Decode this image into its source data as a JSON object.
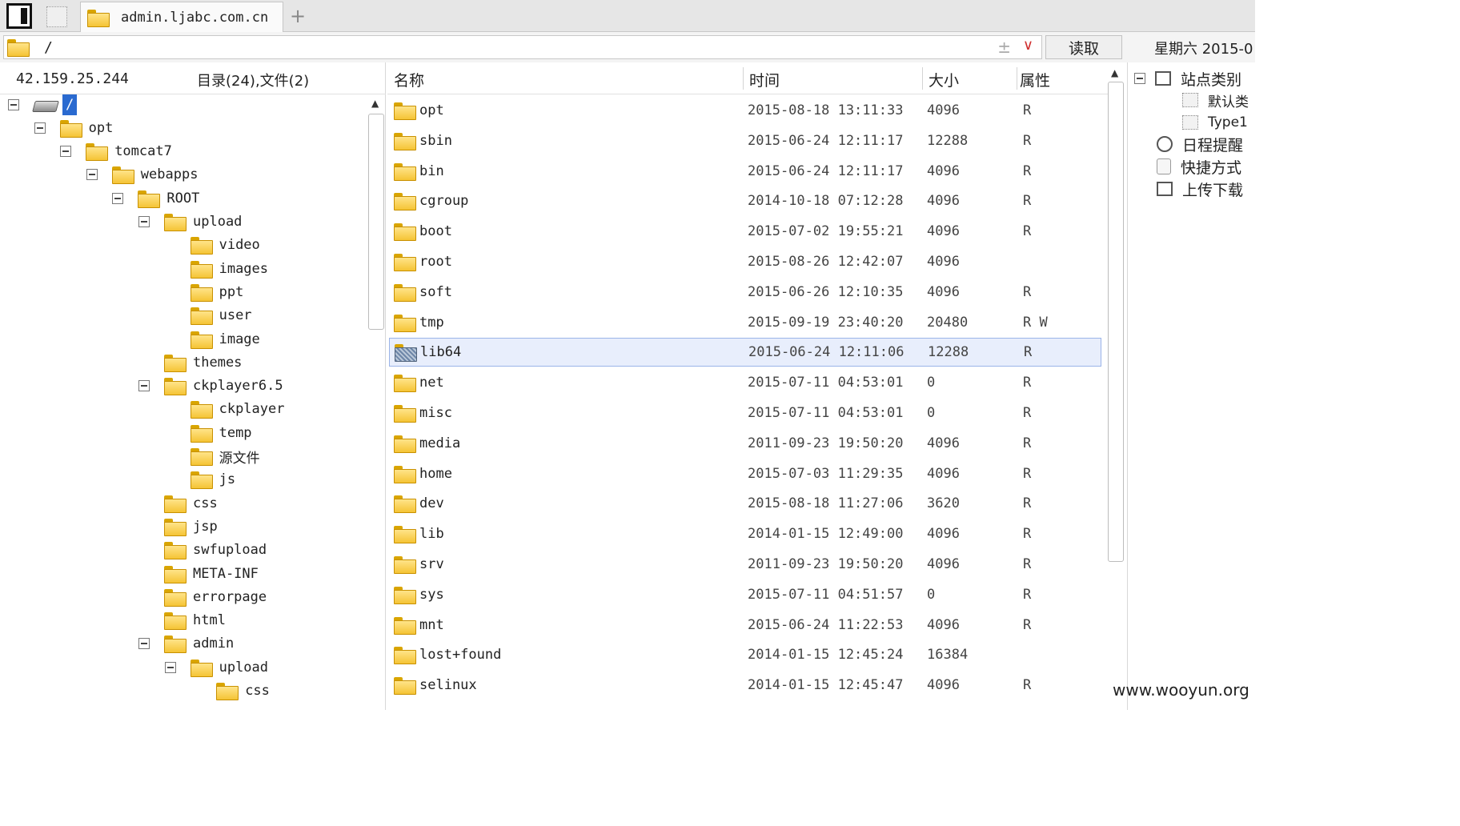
{
  "tab": {
    "title": "admin.ljabc.com.cn"
  },
  "path": {
    "value": "/",
    "read_label": "读取"
  },
  "weekday": "星期六 2015-0",
  "left": {
    "ip": "42.159.25.244",
    "counts": "目录(24),文件(2)",
    "tree": [
      {
        "label": "/",
        "kind": "drive",
        "depth": 0,
        "toggle": true
      },
      {
        "label": "opt",
        "depth": 1,
        "toggle": true
      },
      {
        "label": "tomcat7",
        "depth": 2,
        "toggle": true
      },
      {
        "label": "webapps",
        "depth": 3,
        "toggle": true
      },
      {
        "label": "ROOT",
        "depth": 4,
        "toggle": true
      },
      {
        "label": "upload",
        "depth": 5,
        "toggle": true
      },
      {
        "label": "video",
        "depth": 6
      },
      {
        "label": "images",
        "depth": 6
      },
      {
        "label": "ppt",
        "depth": 6
      },
      {
        "label": "user",
        "depth": 6
      },
      {
        "label": "image",
        "depth": 6
      },
      {
        "label": "themes",
        "depth": 5
      },
      {
        "label": "ckplayer6.5",
        "depth": 5,
        "toggle": true
      },
      {
        "label": "ckplayer",
        "depth": 6
      },
      {
        "label": "temp",
        "depth": 6
      },
      {
        "label": "源文件",
        "depth": 6
      },
      {
        "label": "js",
        "depth": 6
      },
      {
        "label": "css",
        "depth": 5
      },
      {
        "label": "jsp",
        "depth": 5
      },
      {
        "label": "swfupload",
        "depth": 5
      },
      {
        "label": "META-INF",
        "depth": 5
      },
      {
        "label": "errorpage",
        "depth": 5
      },
      {
        "label": "html",
        "depth": 5
      },
      {
        "label": "admin",
        "depth": 5,
        "toggle": true
      },
      {
        "label": "upload",
        "depth": 6,
        "toggle": true
      },
      {
        "label": "css",
        "depth": 7
      }
    ]
  },
  "list": {
    "headers": {
      "name": "名称",
      "time": "时间",
      "size": "大小",
      "attr": "属性"
    },
    "rows": [
      {
        "name": "opt",
        "time": "2015-08-18 13:11:33",
        "size": "4096",
        "attr": "R"
      },
      {
        "name": "sbin",
        "time": "2015-06-24 12:11:17",
        "size": "12288",
        "attr": "R"
      },
      {
        "name": "bin",
        "time": "2015-06-24 12:11:17",
        "size": "4096",
        "attr": "R"
      },
      {
        "name": "cgroup",
        "time": "2014-10-18 07:12:28",
        "size": "4096",
        "attr": "R"
      },
      {
        "name": "boot",
        "time": "2015-07-02 19:55:21",
        "size": "4096",
        "attr": "R"
      },
      {
        "name": "root",
        "time": "2015-08-26 12:42:07",
        "size": "4096",
        "attr": ""
      },
      {
        "name": "soft",
        "time": "2015-06-26 12:10:35",
        "size": "4096",
        "attr": "R"
      },
      {
        "name": "tmp",
        "time": "2015-09-19 23:40:20",
        "size": "20480",
        "attr": "R W"
      },
      {
        "name": "lib64",
        "time": "2015-06-24 12:11:06",
        "size": "12288",
        "attr": "R",
        "selected": true,
        "icon": "mesh"
      },
      {
        "name": "net",
        "time": "2015-07-11 04:53:01",
        "size": "0",
        "attr": "R"
      },
      {
        "name": "misc",
        "time": "2015-07-11 04:53:01",
        "size": "0",
        "attr": "R"
      },
      {
        "name": "media",
        "time": "2011-09-23 19:50:20",
        "size": "4096",
        "attr": "R"
      },
      {
        "name": "home",
        "time": "2015-07-03 11:29:35",
        "size": "4096",
        "attr": "R"
      },
      {
        "name": "dev",
        "time": "2015-08-18 11:27:06",
        "size": "3620",
        "attr": "R"
      },
      {
        "name": "lib",
        "time": "2014-01-15 12:49:00",
        "size": "4096",
        "attr": "R"
      },
      {
        "name": "srv",
        "time": "2011-09-23 19:50:20",
        "size": "4096",
        "attr": "R"
      },
      {
        "name": "sys",
        "time": "2015-07-11 04:51:57",
        "size": "0",
        "attr": "R"
      },
      {
        "name": "mnt",
        "time": "2015-06-24 11:22:53",
        "size": "4096",
        "attr": "R"
      },
      {
        "name": "lost+found",
        "time": "2014-01-15 12:45:24",
        "size": "16384",
        "attr": ""
      },
      {
        "name": "selinux",
        "time": "2014-01-15 12:45:47",
        "size": "4096",
        "attr": "R"
      }
    ]
  },
  "right": {
    "site_category": "站点类别",
    "default_category": "默认类",
    "type1": "Type1",
    "schedule": "日程提醒",
    "shortcut": "快捷方式",
    "transfer": "上传下载"
  },
  "watermark": "www.wooyun.org"
}
